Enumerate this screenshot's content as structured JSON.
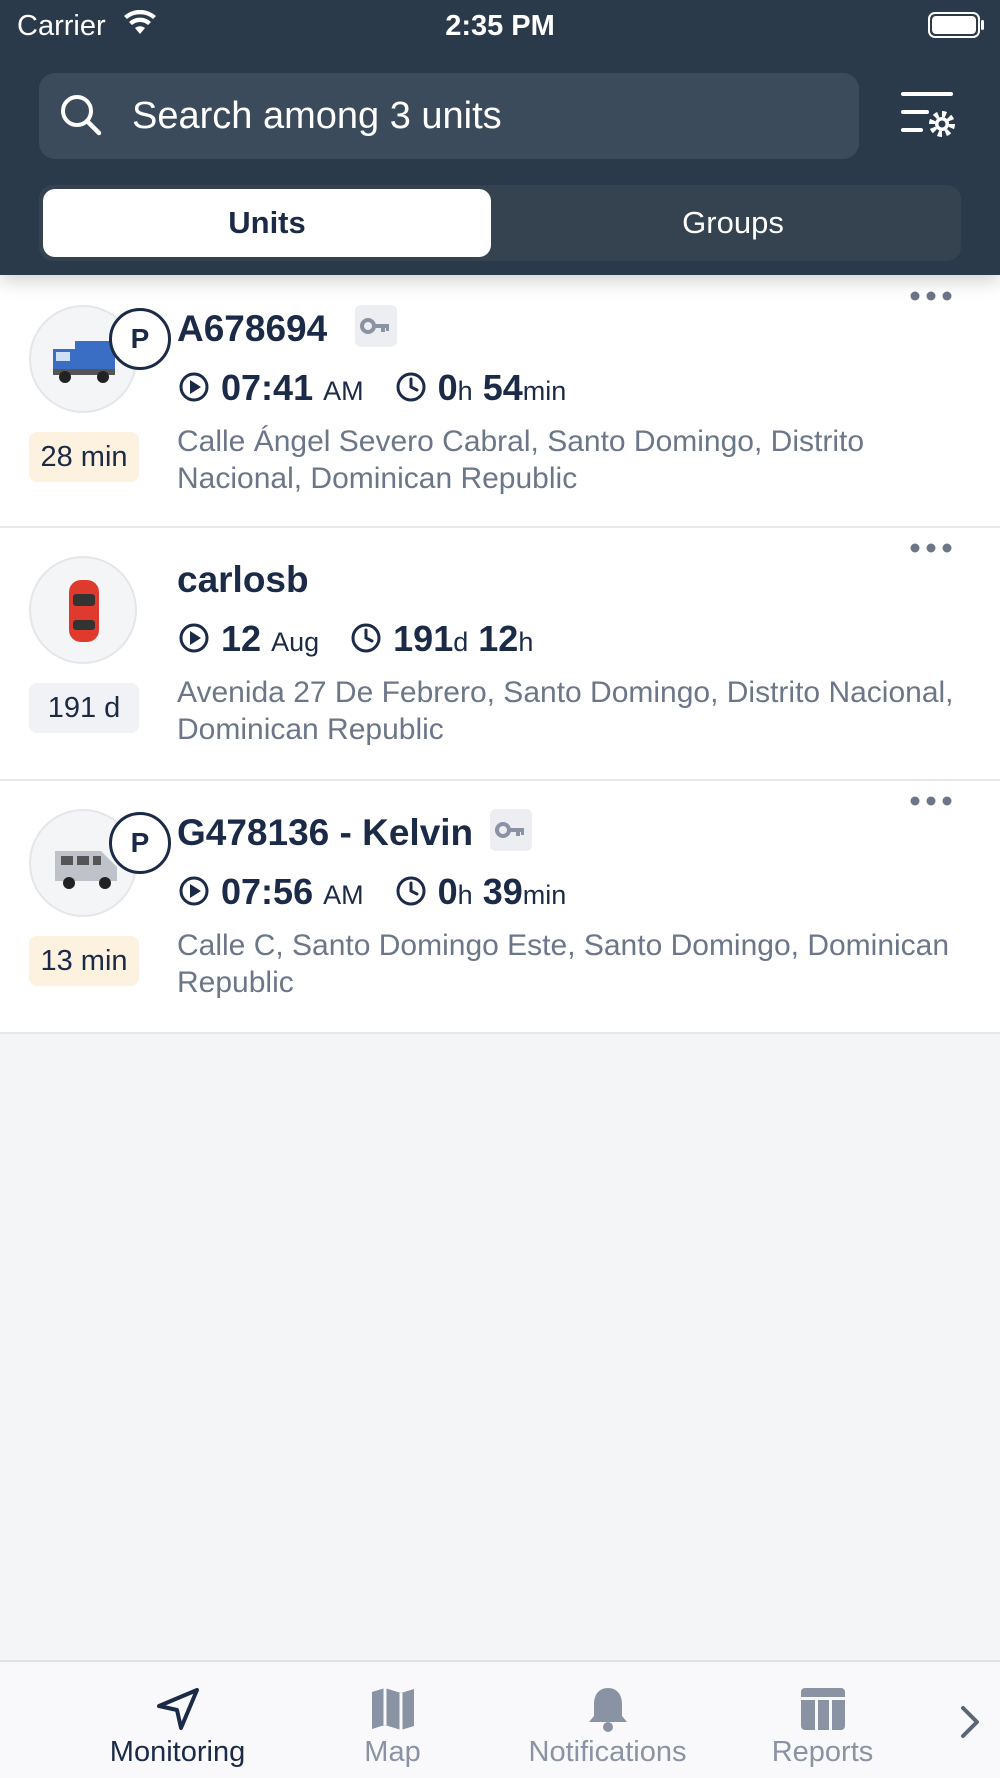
{
  "status_bar": {
    "carrier": "Carrier",
    "time": "2:35 PM"
  },
  "search": {
    "placeholder": "Search among 3 units"
  },
  "segments": {
    "units": "Units",
    "groups": "Groups"
  },
  "units": [
    {
      "name": "A678694",
      "badge": "P",
      "age": "28 min",
      "start_time": "07:41",
      "start_unit": "AM",
      "dur_a": "0",
      "dur_a_unit": "h",
      "dur_b": "54",
      "dur_b_unit": "min",
      "address": "Calle Ángel Severo Cabral, Santo Domingo, Distrito Nacional, Dominican Republic",
      "icon": "truck-icon",
      "age_color": "#fdf1df"
    },
    {
      "name": "carlosb",
      "badge": "",
      "age": "191 d",
      "start_time": "12",
      "start_unit": "Aug",
      "dur_a": "191",
      "dur_a_unit": "d",
      "dur_b": "12",
      "dur_b_unit": "h",
      "address": "Avenida 27 De Febrero, Santo Domingo, Distrito Nacional, Dominican Republic",
      "icon": "car-icon",
      "age_color": "#f1f2f5"
    },
    {
      "name": "G478136 - Kelvin",
      "badge": "P",
      "age": "13 min",
      "start_time": "07:56",
      "start_unit": "AM",
      "dur_a": "0",
      "dur_a_unit": "h",
      "dur_b": "39",
      "dur_b_unit": "min",
      "address": "Calle C, Santo Domingo Este, Santo Domingo, Dominican Republic",
      "icon": "van-icon",
      "age_color": "#fdf1df"
    }
  ],
  "tabs": {
    "monitoring": "Monitoring",
    "map": "Map",
    "notifications": "Notifications",
    "reports": "Reports"
  },
  "colors": {
    "header": "#2b3a4b",
    "text": "#1b2a47",
    "muted": "#6c7689"
  }
}
